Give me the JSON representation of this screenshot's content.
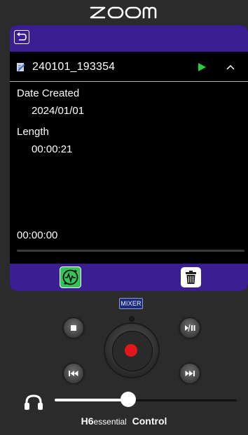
{
  "app": {
    "logo_text": "ZOOM"
  },
  "file": {
    "name": "240101_193354",
    "date_created_label": "Date Created",
    "date_created_value": "2024/01/01",
    "length_label": "Length",
    "length_value": "00:00:21"
  },
  "player": {
    "position": "00:00:00",
    "progress_fraction": 0.0
  },
  "controls": {
    "mixer_label": "MIXER",
    "volume_fraction": 0.4
  },
  "brand": {
    "model_bold": "H6",
    "model_small": "essential",
    "suffix": "Control"
  },
  "colors": {
    "accent": "#3b1f92",
    "play_green": "#1fcf3d",
    "record_red": "#e0181b",
    "convert_green": "#37c25a"
  },
  "icons": {
    "back": "back-icon",
    "file": "file-icon",
    "play": "play-icon",
    "collapse": "chevron-up-icon",
    "convert": "convert-icon",
    "trash": "trash-icon",
    "stop": "stop-icon",
    "play_pause": "play-pause-icon",
    "prev": "previous-icon",
    "next": "next-icon",
    "headphones": "headphones-icon"
  }
}
